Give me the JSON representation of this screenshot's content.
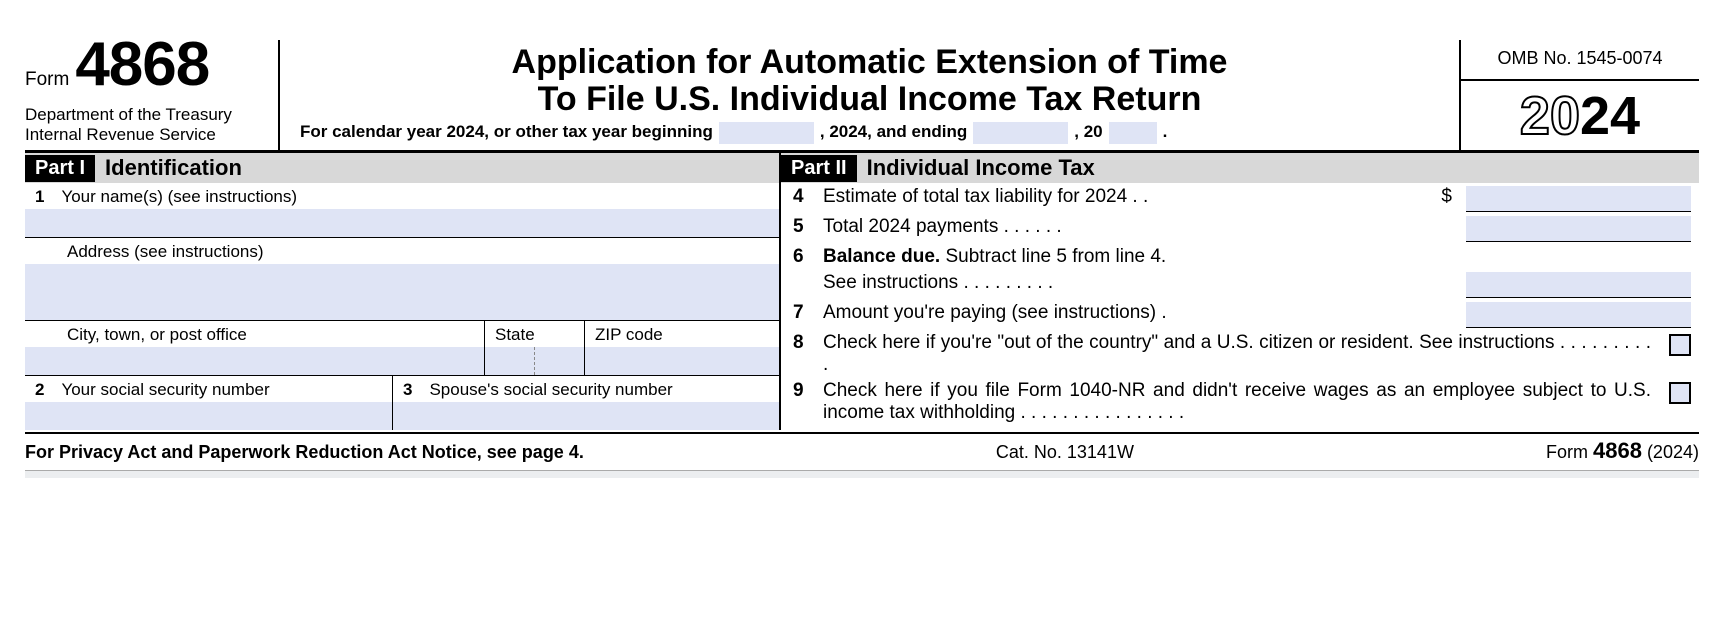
{
  "header": {
    "form_word": "Form",
    "form_number": "4868",
    "department_line1": "Department of the Treasury",
    "department_line2": "Internal Revenue Service",
    "title_line1": "Application for Automatic Extension of Time",
    "title_line2": "To File U.S. Individual Income Tax Return",
    "calendar_prefix": "For calendar year 2024, or other tax year beginning",
    "calendar_mid": ", 2024, and ending",
    "calendar_suffix1": ", 20",
    "calendar_suffix2": ".",
    "omb": "OMB No. 1545-0074",
    "year_ghost": "20",
    "year_bold": "24"
  },
  "part1": {
    "bar_label": "Part I",
    "bar_title": "Identification",
    "line1_num": "1",
    "line1_label": "Your name(s) (see instructions)",
    "addr_label": "Address (see instructions)",
    "city_label": "City, town, or post office",
    "state_label": "State",
    "zip_label": "ZIP code",
    "line2_num": "2",
    "line2_label": "Your social security number",
    "line3_num": "3",
    "line3_label": "Spouse's social security number"
  },
  "part2": {
    "bar_label": "Part II",
    "bar_title": "Individual Income Tax",
    "line4_num": "4",
    "line4_text": "Estimate of total tax liability for 2024 .    .",
    "line5_num": "5",
    "line5_text": "Total 2024 payments   .    .    .    .    .    .",
    "line6_num": "6",
    "line6_text_a": "Balance due.",
    "line6_text_b": " Subtract line 5 from line 4.",
    "line6_text_c": "See instructions .    .    .    .    .    .    .    .    .",
    "line7_num": "7",
    "line7_text": "Amount you're paying (see instructions) .",
    "line8_num": "8",
    "line8_text": "Check here if you're \"out of the country\" and a U.S. citizen or resident. See instructions    .    .    .    .    .    .    .    .    .    .",
    "line9_num": "9",
    "line9_text": "Check here if you file Form 1040-NR and didn't receive wages as an employee subject to U.S. income tax withholding   .   .   .   .   .   .   .   .   .   .   .   .   .   .   .   .",
    "dollar": "$"
  },
  "footer": {
    "left": "For Privacy Act and Paperwork Reduction Act Notice, see page 4.",
    "center": "Cat. No. 13141W",
    "right_prefix": "Form ",
    "right_formnum": "4868",
    "right_suffix": " (2024)"
  },
  "values": {
    "tax_year_begin": "",
    "tax_year_end_month": "",
    "tax_year_end_yy": "",
    "name": "",
    "address1": "",
    "address2": "",
    "city": "",
    "state": "",
    "zip": "",
    "ssn": "",
    "spouse_ssn": "",
    "line4": "",
    "line5": "",
    "line6": "",
    "line7": ""
  }
}
